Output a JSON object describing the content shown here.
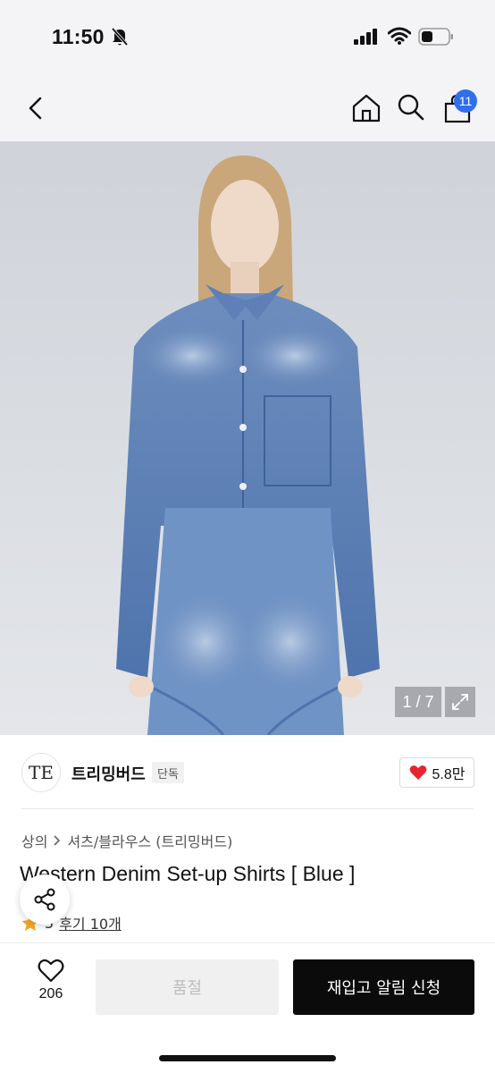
{
  "status_bar": {
    "time": "11:50"
  },
  "nav": {
    "cart_count": "11"
  },
  "gallery": {
    "counter": "1 / 7"
  },
  "brand": {
    "logo_text": "TE",
    "name": "트리밍버드",
    "badge": "단독",
    "likes": "5.8만"
  },
  "product": {
    "breadcrumb": [
      "상의",
      "셔츠/블라우스 (트리밍버드)"
    ],
    "title": "Western Denim Set-up Shirts [ Blue ]",
    "rating": "5",
    "reviews": "후기 10개"
  },
  "bottom": {
    "wish_count": "206",
    "soldout_label": "품절",
    "restock_label": "재입고 알림 신청"
  },
  "colors": {
    "accent_blue": "#2f6fed",
    "like_red": "#e8242e",
    "star": "#f5a623",
    "primary_button": "#0b0b0b"
  }
}
